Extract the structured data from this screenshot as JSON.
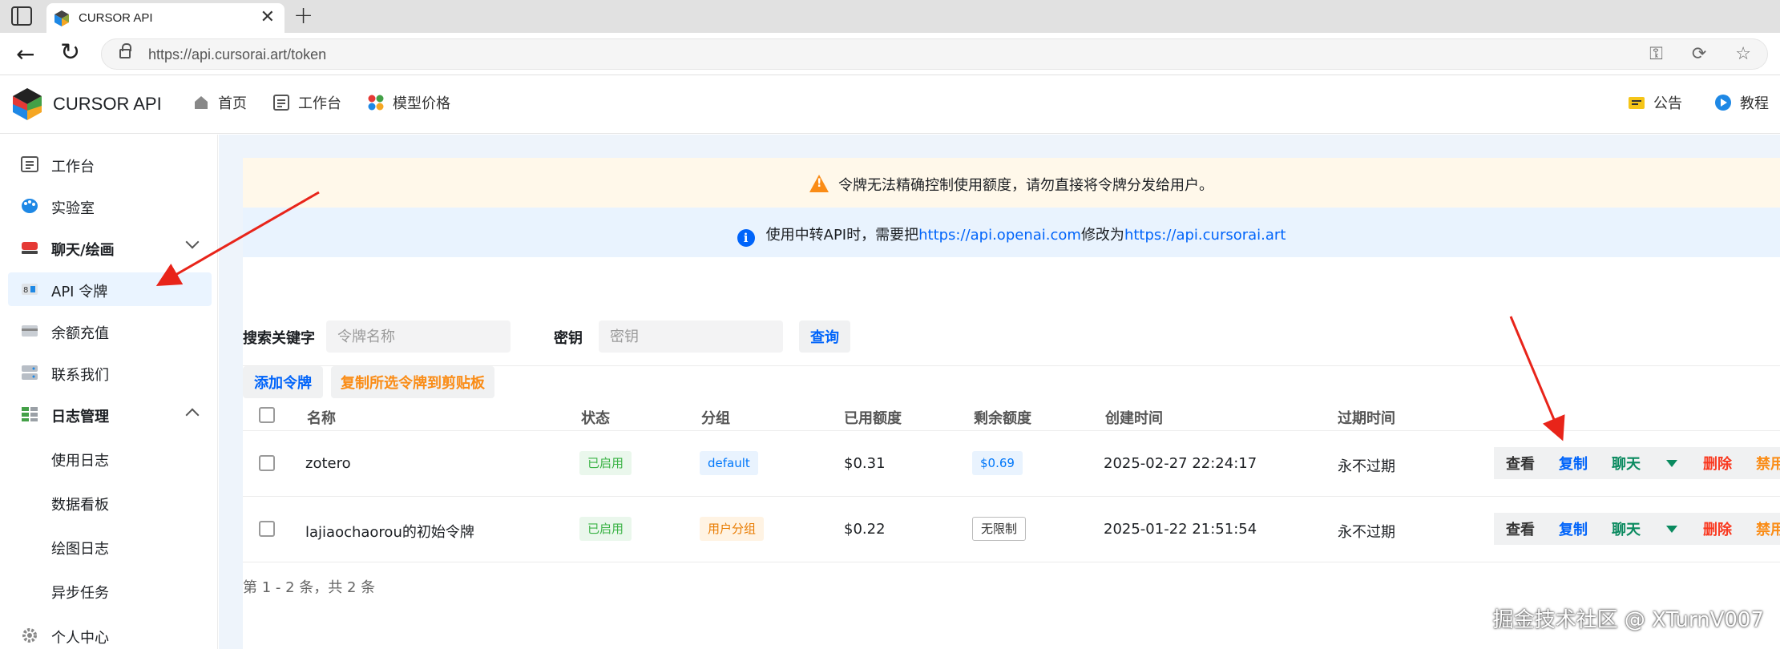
{
  "browser": {
    "tab_title": "CURSOR API",
    "url_prefix": "https://",
    "url_host": "api.cursorai.art",
    "url_path": "/token"
  },
  "header": {
    "brand": "CURSOR API",
    "nav": [
      {
        "label": "首页",
        "icon": "home-icon"
      },
      {
        "label": "工作台",
        "icon": "dashboard-icon"
      },
      {
        "label": "模型价格",
        "icon": "palette-dots-icon"
      }
    ],
    "right": [
      {
        "label": "公告",
        "icon": "announcement-icon"
      },
      {
        "label": "教程",
        "icon": "play-icon"
      }
    ]
  },
  "sidebar": {
    "items": [
      {
        "label": "工作台",
        "icon": "dashboard-icon"
      },
      {
        "label": "实验室",
        "icon": "palette-icon"
      },
      {
        "label": "聊天/绘画",
        "icon": "chat-icon"
      },
      {
        "label": "API 令牌",
        "icon": "token-icon"
      },
      {
        "label": "余额充值",
        "icon": "wallet-icon"
      },
      {
        "label": "联系我们",
        "icon": "server-icon"
      },
      {
        "label": "日志管理",
        "icon": "table-icon"
      },
      {
        "label": "使用日志"
      },
      {
        "label": "数据看板"
      },
      {
        "label": "绘图日志"
      },
      {
        "label": "异步任务"
      },
      {
        "label": "个人中心",
        "icon": "gear-icon"
      }
    ]
  },
  "banners": {
    "warning": "令牌无法精确控制使用额度，请勿直接将令牌分发给用户。",
    "info_pre": "使用中转API时，需要把",
    "info_link1": "https://api.openai.com",
    "info_mid": "修改为",
    "info_link2": "https://api.cursorai.art"
  },
  "search": {
    "keyword_label": "搜索关键字",
    "keyword_placeholder": "令牌名称",
    "key_label": "密钥",
    "key_placeholder": "密钥",
    "query_button": "查询"
  },
  "toolbar": {
    "add_button": "添加令牌",
    "copy_selected_button": "复制所选令牌到剪贴板"
  },
  "table": {
    "columns": [
      "名称",
      "状态",
      "分组",
      "已用额度",
      "剩余额度",
      "创建时间",
      "过期时间"
    ],
    "rows": [
      {
        "name": "zotero",
        "status": "已启用",
        "group": "default",
        "used": "$0.31",
        "remaining": "$0.69",
        "created": "2025-02-27 22:24:17",
        "expires": "永不过期"
      },
      {
        "name": "lajiaochaorou的初始令牌",
        "status": "已启用",
        "group": "用户分组",
        "used": "$0.22",
        "remaining": "无限制",
        "created": "2025-01-22 21:51:54",
        "expires": "永不过期"
      }
    ],
    "actions": {
      "view": "查看",
      "copy": "复制",
      "chat": "聊天",
      "delete": "删除",
      "disable": "禁用"
    }
  },
  "pager": "第 1 - 2 条，共 2 条",
  "watermark": "掘金技术社区 @ XTurnV007",
  "colors": {
    "primary": "#0064fa",
    "warning": "#fa8c16",
    "danger": "#f93920",
    "success": "#3bb346",
    "annotation_arrow": "#e8241a"
  }
}
